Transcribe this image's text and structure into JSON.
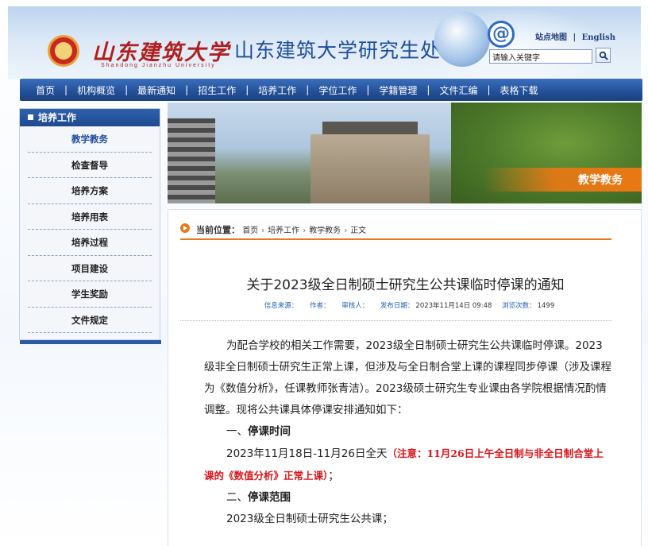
{
  "header": {
    "logo_script": "山东建筑大学",
    "logo_pinyin": "Shandong Jianzhu University",
    "site_title": "山东建筑大学研究生处",
    "link_sitemap": "站点地图",
    "link_separator": "|",
    "link_english": "English",
    "search_placeholder": "请输入关键字",
    "search_value": "请输入关键字"
  },
  "nav": {
    "items": [
      "首页",
      "机构概览",
      "最新通知",
      "招生工作",
      "培养工作",
      "学位工作",
      "学籍管理",
      "文件汇编",
      "表格下载"
    ]
  },
  "sidebar": {
    "title": "培养工作",
    "items": [
      "教学教务",
      "检查督导",
      "培养方案",
      "培养用表",
      "培养过程",
      "项目建设",
      "学生奖励",
      "文件规定"
    ],
    "active_index": 0
  },
  "banner": {
    "label": "教学教务"
  },
  "breadcrumb": {
    "label": "当前位置：",
    "items": [
      "首页",
      "培养工作",
      "教学教务",
      "正文"
    ]
  },
  "article": {
    "title": "关于2023级全日制硕士研究生公共课临时停课的通知",
    "meta": {
      "source_label": "信息来源：",
      "source_value": "",
      "author_label": "作者：",
      "author_value": "",
      "reviewer_label": "审核人：",
      "reviewer_value": "",
      "date_label": "发布日期：",
      "date_value": "2023年11月14日 09:48",
      "views_label": "浏览次数：",
      "views_value": "1499"
    },
    "paragraph1": "为配合学校的相关工作需要，2023级全日制硕士研究生公共课临时停课。2023级非全日制硕士研究生正常上课，但涉及与全日制合堂上课的课程同步停课（涉及课程为《数值分析》，任课教师张青洁）。2023级硕士研究生专业课由各学院根据情况酌情调整。现将公共课具体停课安排通知如下：",
    "section1_number": "一、",
    "section1_title": "停课时间",
    "section1_text": "2023年11月18日-11月26日全天",
    "section1_note": "（注意：11月26日上午全日制与非全日制合堂上课的《数值分析》正常上课）",
    "section1_end": "；",
    "section2_number": "二、",
    "section2_title": "停课范围",
    "section2_text": "2023级全日制硕士研究生公共课；"
  },
  "colors": {
    "nav_blue": "#234f97",
    "accent_orange": "#e87a1e",
    "title_blue": "#1f4e9a",
    "note_red": "#d8141a",
    "meta_blue": "#1f5fb8"
  }
}
